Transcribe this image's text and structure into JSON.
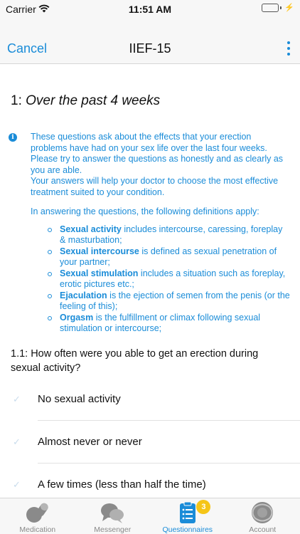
{
  "status_bar": {
    "carrier": "Carrier",
    "time": "11:51 AM"
  },
  "nav": {
    "cancel_label": "Cancel",
    "title": "IIEF-15"
  },
  "section": {
    "number": "1:",
    "title": "Over the past 4 weeks"
  },
  "info": {
    "paragraph1": "These questions ask about the effects that your erection problems have had on your sex life over the last four weeks. Please try to answer the questions as honestly and as clearly as you are able.",
    "paragraph2": "Your answers will help your doctor to choose the most effective treatment suited to your condition.",
    "definitions_intro": "In answering the questions, the following definitions apply:",
    "definitions": [
      {
        "term": "Sexual activity",
        "text": " includes intercourse, caressing, foreplay & masturbation;"
      },
      {
        "term": "Sexual intercourse",
        "text": " is defined as sexual penetration of your partner;"
      },
      {
        "term": "Sexual stimulation",
        "text": " includes a situation such as foreplay, erotic pictures etc.;"
      },
      {
        "term": "Ejaculation",
        "text": " is the ejection of semen from the penis (or the feeling of this);"
      },
      {
        "term": "Orgasm",
        "text": " is the fulfillment or climax following sexual stimulation or intercourse;"
      }
    ]
  },
  "question": {
    "text": "1.1: How often were you able to get an erection during sexual activity?"
  },
  "options": [
    {
      "label": "No sexual activity"
    },
    {
      "label": "Almost never or never"
    },
    {
      "label": "A few times (less than half the time)"
    }
  ],
  "tabs": [
    {
      "label": "Medication",
      "icon": "pills-icon"
    },
    {
      "label": "Messenger",
      "icon": "chat-bubbles-icon"
    },
    {
      "label": "Questionnaires",
      "icon": "clipboard-icon",
      "badge": "3"
    },
    {
      "label": "Account",
      "icon": "account-icon"
    }
  ],
  "colors": {
    "accent": "#1a8cd8",
    "badge": "#f5c518",
    "battery": "#4cd964"
  }
}
